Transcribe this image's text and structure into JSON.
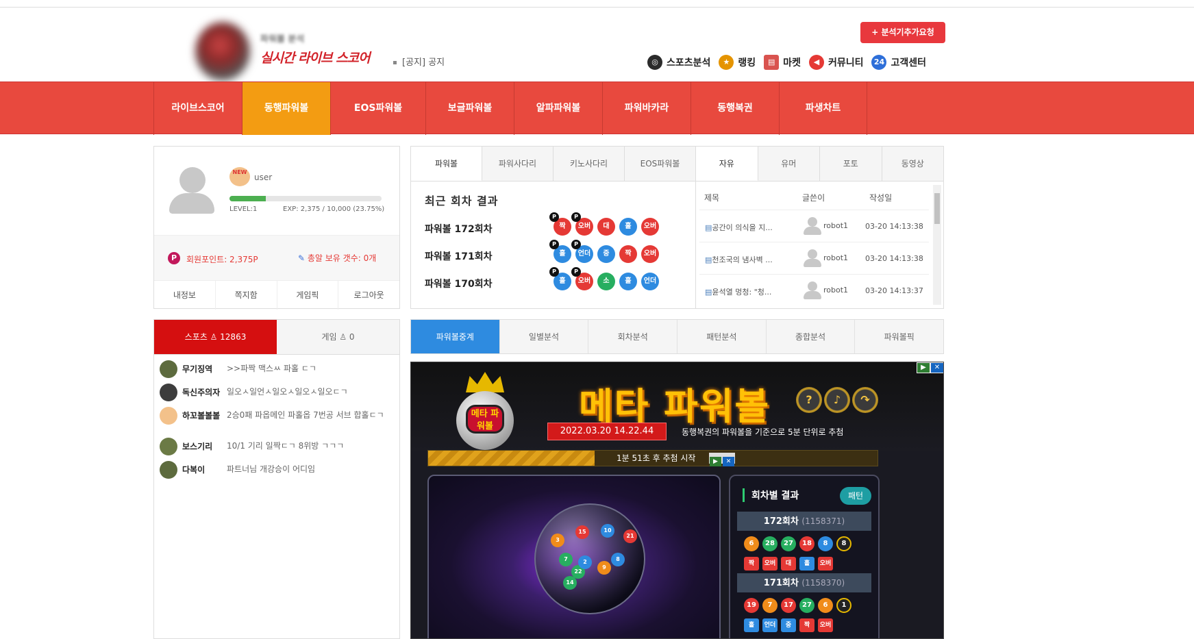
{
  "header": {
    "logo_small": "파워볼 분석",
    "logo_main": "실시간 라이브 스코어",
    "notice": "[공지] 공지",
    "request_button": "+ 분석기추가요청",
    "topnav": [
      {
        "label": "스포츠분석",
        "icon": "target-icon",
        "color": "#2b2b2b"
      },
      {
        "label": "랭킹",
        "icon": "medal-icon",
        "color": "#e59400"
      },
      {
        "label": "마켓",
        "icon": "shop-icon",
        "color": "#d9534f"
      },
      {
        "label": "커뮤니티",
        "icon": "megaphone-icon",
        "color": "#e53935"
      },
      {
        "label": "고객센터",
        "icon": "support-24-icon",
        "color": "#2e6fd9"
      }
    ]
  },
  "menu": {
    "items": [
      "라이브스코어",
      "동행파워볼",
      "EOS파워볼",
      "보글파워볼",
      "알파파워볼",
      "파워바카라",
      "동행복권",
      "파생차트"
    ],
    "active_index": 1,
    "colors": {
      "bar": "#e8493e",
      "active": "#f39c12"
    }
  },
  "user": {
    "badge": "NEW",
    "name": "user",
    "level": "LEVEL:1",
    "exp": "EXP: 2,375 / 10,000 (23.75%)",
    "exp_ratio": 0.2375,
    "points": "회원포인트: 2,375P",
    "bombs": "총알 보유 갯수: 0개",
    "actions": [
      "내정보",
      "쪽지함",
      "게임픽",
      "로그아웃"
    ]
  },
  "results": {
    "tabs": [
      "파워볼",
      "파워사다리",
      "키노사다리",
      "EOS파워볼"
    ],
    "title": "최근 회차 결과",
    "rows": [
      {
        "label": "파워볼 172회차",
        "balls": [
          {
            "t": "짝",
            "c": "red",
            "p": true
          },
          {
            "t": "오버",
            "c": "red",
            "p": true
          },
          {
            "t": "대",
            "c": "red"
          },
          {
            "t": "홀",
            "c": "blue"
          },
          {
            "t": "오버",
            "c": "red"
          }
        ]
      },
      {
        "label": "파워볼 171회차",
        "balls": [
          {
            "t": "홀",
            "c": "blue",
            "p": true
          },
          {
            "t": "언더",
            "c": "blue",
            "p": true
          },
          {
            "t": "중",
            "c": "blue"
          },
          {
            "t": "짝",
            "c": "red"
          },
          {
            "t": "오버",
            "c": "red"
          }
        ]
      },
      {
        "label": "파워볼 170회차",
        "balls": [
          {
            "t": "홀",
            "c": "blue",
            "p": true
          },
          {
            "t": "오버",
            "c": "red",
            "p": true
          },
          {
            "t": "소",
            "c": "green"
          },
          {
            "t": "홀",
            "c": "blue"
          },
          {
            "t": "언더",
            "c": "blue"
          }
        ]
      }
    ]
  },
  "board": {
    "tabs": [
      "자유",
      "유머",
      "포토",
      "동영상"
    ],
    "headers": {
      "title": "제목",
      "writer": "글쓴이",
      "date": "작성일"
    },
    "rows": [
      {
        "title": "공간이 의식을 지...",
        "writer": "robot1",
        "date": "03-20 14:13:38"
      },
      {
        "title": "천조국의 냄사벽 ...",
        "writer": "robot1",
        "date": "03-20 14:13:38"
      },
      {
        "title": "윤석열 멍청: \"청...",
        "writer": "robot1",
        "date": "03-20 14:13:37"
      }
    ]
  },
  "chat": {
    "tabs": [
      {
        "label": "스포츠 ♙ 12863"
      },
      {
        "label": "게임 ♙ 0"
      }
    ],
    "messages": [
      {
        "name": "무기징역",
        "msg": ">>파짝 맥스ㅆ 파홀 ㄷㄱ"
      },
      {
        "name": "독신주의자",
        "msg": "일오ㅅ일언ㅅ일오ㅅ일오ㅅ일오ㄷㄱ"
      },
      {
        "name": "하꼬볼볼볼",
        "msg": "2승0패 파옵메인 파홀옵 7번공 서브 합홀ㄷㄱ"
      },
      {
        "name": "보스기리",
        "msg": "10/1 기리 일짝ㄷㄱ 8위방 ㄱㄱㄱ"
      },
      {
        "name": "다복이",
        "msg": "파트너님 개강승이 어디임"
      }
    ]
  },
  "analysis_tabs": [
    "파워볼중계",
    "일별분석",
    "회차분석",
    "패턴분석",
    "종합분석",
    "파워볼픽"
  ],
  "game": {
    "logo_text": "메타 파워볼",
    "title": "메타 파워볼",
    "datetime": "2022.03.20 14.22.44",
    "desc": "동행복권의 파워볼을 기준으로 5분 단위로 추첨",
    "timer_text": "1분 51초 후 추첨 시작",
    "timer_ratio": 0.37,
    "results_title": "회차별 결과",
    "pattern_button": "패턴",
    "buttons": [
      "help-icon",
      "sound-icon",
      "share-icon"
    ],
    "rounds": [
      {
        "label": "172회차",
        "sub": "(1158371)",
        "nums": [
          {
            "n": "6",
            "c": "#f08c1a"
          },
          {
            "n": "28",
            "c": "#27ae60"
          },
          {
            "n": "27",
            "c": "#27ae60"
          },
          {
            "n": "18",
            "c": "#e53935"
          },
          {
            "n": "8",
            "c": "#2e8be0"
          },
          {
            "n": "8",
            "c": "#222",
            "ring": true
          }
        ],
        "tags": [
          {
            "t": "짝",
            "c": "#e53935"
          },
          {
            "t": "오버",
            "c": "#e53935"
          },
          {
            "t": "대",
            "c": "#e53935"
          },
          {
            "t": "홀",
            "c": "#2e8be0"
          },
          {
            "t": "오버",
            "c": "#e53935"
          }
        ]
      },
      {
        "label": "171회차",
        "sub": "(1158370)",
        "nums": [
          {
            "n": "19",
            "c": "#e53935"
          },
          {
            "n": "7",
            "c": "#f08c1a"
          },
          {
            "n": "17",
            "c": "#e53935"
          },
          {
            "n": "27",
            "c": "#27ae60"
          },
          {
            "n": "6",
            "c": "#f08c1a"
          },
          {
            "n": "1",
            "c": "#222",
            "ring": true
          }
        ],
        "tags": [
          {
            "t": "홀",
            "c": "#2e8be0"
          },
          {
            "t": "언더",
            "c": "#2e8be0"
          },
          {
            "t": "중",
            "c": "#2e8be0"
          },
          {
            "t": "짝",
            "c": "#e53935"
          },
          {
            "t": "오버",
            "c": "#e53935"
          }
        ]
      }
    ],
    "sphere_balls": [
      {
        "n": "3",
        "c": "#f08c1a"
      },
      {
        "n": "15",
        "c": "#e53935"
      },
      {
        "n": "10",
        "c": "#2e8be0"
      },
      {
        "n": "21",
        "c": "#e53935"
      },
      {
        "n": "7",
        "c": "#27ae60"
      },
      {
        "n": "22",
        "c": "#27ae60"
      },
      {
        "n": "8",
        "c": "#2e8be0"
      },
      {
        "n": "9",
        "c": "#f08c1a"
      },
      {
        "n": "14",
        "c": "#27ae60"
      },
      {
        "n": "2",
        "c": "#2e8be0"
      }
    ]
  }
}
